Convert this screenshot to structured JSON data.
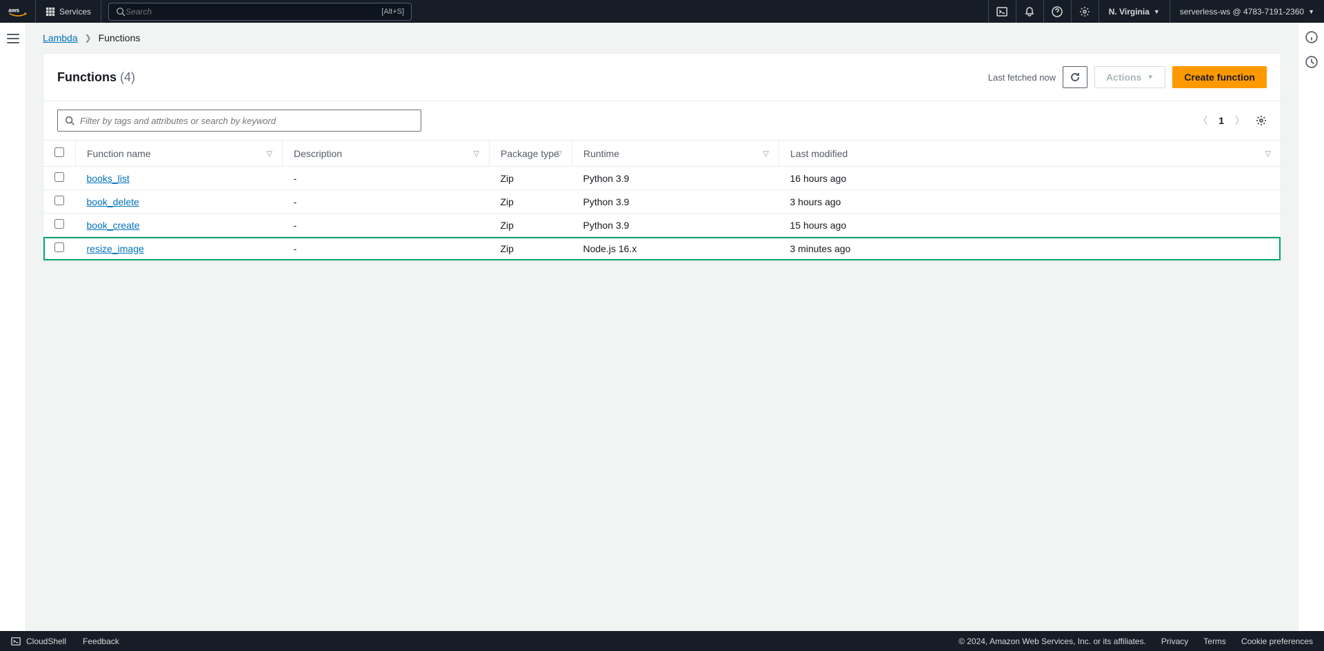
{
  "top": {
    "services_label": "Services",
    "search_placeholder": "Search",
    "search_shortcut": "[Alt+S]",
    "region": "N. Virginia",
    "account": "serverless-ws @ 4783-7191-2360"
  },
  "breadcrumb": {
    "root": "Lambda",
    "current": "Functions"
  },
  "header": {
    "title": "Functions",
    "count": "(4)",
    "last_fetched": "Last fetched now",
    "actions_label": "Actions",
    "create_label": "Create function"
  },
  "filter": {
    "placeholder": "Filter by tags and attributes or search by keyword"
  },
  "pager": {
    "page": "1"
  },
  "columns": {
    "name": "Function name",
    "desc": "Description",
    "pkg": "Package type",
    "runtime": "Runtime",
    "modified": "Last modified"
  },
  "rows": [
    {
      "name": "books_list",
      "desc": "-",
      "pkg": "Zip",
      "runtime": "Python 3.9",
      "modified": "16 hours ago",
      "highlight": false
    },
    {
      "name": "book_delete",
      "desc": "-",
      "pkg": "Zip",
      "runtime": "Python 3.9",
      "modified": "3 hours ago",
      "highlight": false
    },
    {
      "name": "book_create",
      "desc": "-",
      "pkg": "Zip",
      "runtime": "Python 3.9",
      "modified": "15 hours ago",
      "highlight": false
    },
    {
      "name": "resize_image",
      "desc": "-",
      "pkg": "Zip",
      "runtime": "Node.js 16.x",
      "modified": "3 minutes ago",
      "highlight": true
    }
  ],
  "footer": {
    "cloudshell": "CloudShell",
    "feedback": "Feedback",
    "copyright": "© 2024, Amazon Web Services, Inc. or its affiliates.",
    "privacy": "Privacy",
    "terms": "Terms",
    "cookies": "Cookie preferences"
  }
}
